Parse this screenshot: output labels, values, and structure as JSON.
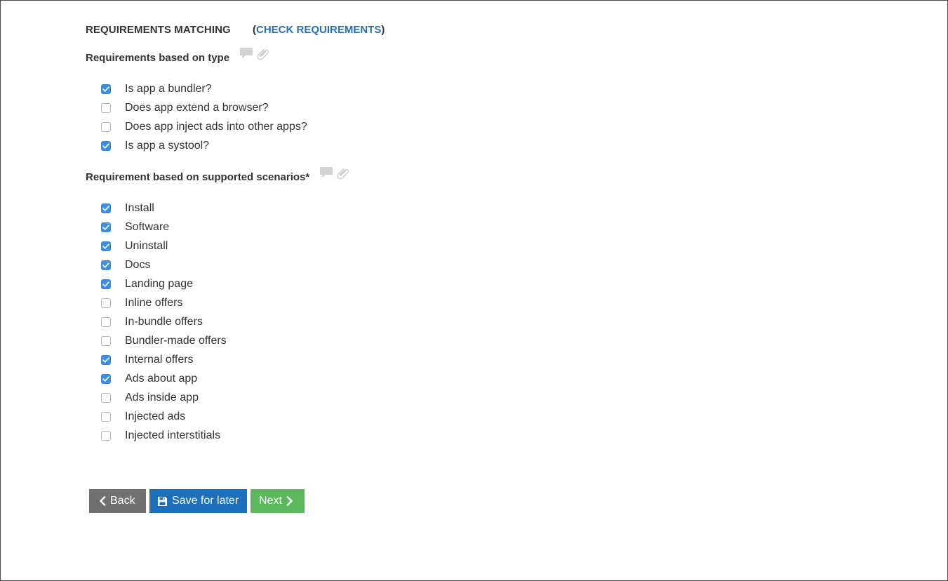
{
  "header": {
    "title": "REQUIREMENTS MATCHING",
    "paren_open": "(",
    "link_label": "CHECK REQUIREMENTS",
    "paren_close": ")"
  },
  "type_section": {
    "title": "Requirements based on type",
    "items": [
      {
        "label": "Is app a bundler?",
        "checked": true
      },
      {
        "label": "Does app extend a browser?",
        "checked": false
      },
      {
        "label": "Does app inject ads into other apps?",
        "checked": false
      },
      {
        "label": "Is app a systool?",
        "checked": true
      }
    ]
  },
  "scenario_section": {
    "title": "Requirement based on supported scenarios*",
    "items": [
      {
        "label": "Install",
        "checked": true
      },
      {
        "label": "Software",
        "checked": true
      },
      {
        "label": "Uninstall",
        "checked": true
      },
      {
        "label": "Docs",
        "checked": true
      },
      {
        "label": "Landing page",
        "checked": true
      },
      {
        "label": "Inline offers",
        "checked": false
      },
      {
        "label": "In-bundle offers",
        "checked": false
      },
      {
        "label": "Bundler-made offers",
        "checked": false
      },
      {
        "label": "Internal offers",
        "checked": true
      },
      {
        "label": "Ads about app",
        "checked": true
      },
      {
        "label": "Ads inside app",
        "checked": false
      },
      {
        "label": "Injected ads",
        "checked": false
      },
      {
        "label": "Injected interstitials",
        "checked": false
      }
    ]
  },
  "buttons": {
    "back_label": "Back",
    "save_label": "Save for later",
    "next_label": "Next"
  },
  "colors": {
    "link": "#2a6eb5",
    "checkbox_checked": "#3d8fe6",
    "back_button": "#707070",
    "save_button": "#1e6fba",
    "next_button": "#5cb85c"
  },
  "icons": {
    "comment": "comment-icon",
    "attachment": "paperclip-icon",
    "back": "chevron-left-icon",
    "save": "floppy-disk-icon",
    "next": "chevron-right-icon"
  }
}
